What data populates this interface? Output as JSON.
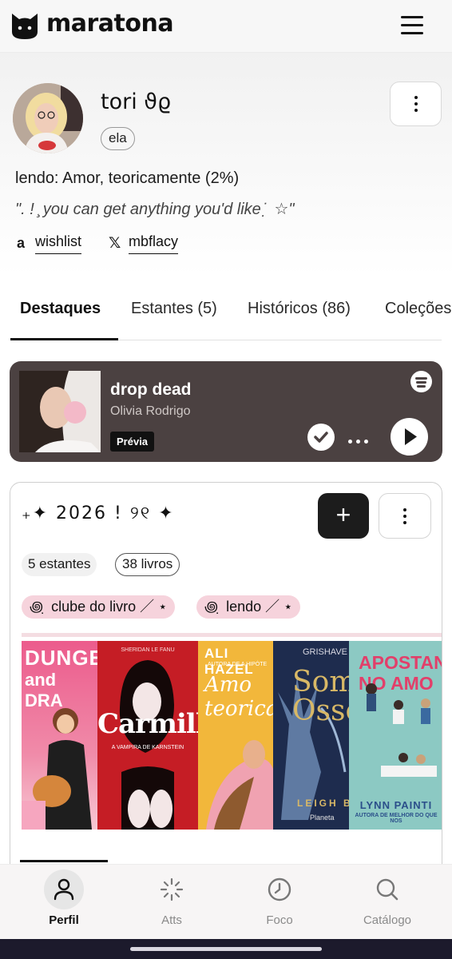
{
  "app": {
    "name": "maratona"
  },
  "profile": {
    "username": "tori ϑϱ",
    "pronoun": "ela",
    "reading": "lendo: Amor, teoricamente (2%)",
    "bio": "\". ! ̧ you can get anything you'd like ̇ ̣ ☆\"",
    "links": [
      {
        "label": "wishlist",
        "icon": "amazon-icon"
      },
      {
        "label": "mbflacy",
        "icon": "x-icon"
      }
    ]
  },
  "tabs": [
    {
      "label": "Destaques",
      "active": true
    },
    {
      "label": "Estantes (5)",
      "active": false
    },
    {
      "label": "Históricos (86)",
      "active": false
    },
    {
      "label": "Coleções",
      "active": false
    }
  ],
  "spotify": {
    "song": "drop dead",
    "artist": "Olivia Rodrigo",
    "badge": "Prévia"
  },
  "collection": {
    "title": "₊✦ 2026 ! ୨୧ ✦",
    "stats": [
      "5 estantes",
      "38 livros"
    ],
    "tags": [
      "꩜ ̣ clube do livro ／ ⋆",
      "꩜ ̣ lendo ／ ⋆"
    ],
    "books": [
      {
        "title_top": "DUNGE",
        "title_bottom": "and DRA"
      },
      {
        "author": "SHERIDAN LE FANU",
        "title": "Carmilla",
        "subtitle": "A VAMPIRA DE KARNSTEIN"
      },
      {
        "author": "ALI HAZEL",
        "tagline": "AUTORA DE A HIPÓTE",
        "title": "Amo teoricam"
      },
      {
        "author": "GRISHAVE",
        "title": "Some Osso",
        "byline": "LEIGH BAR",
        "publisher": "Planeta"
      },
      {
        "title": "APOSTANI NO AMO",
        "author": "LYNN PAINTI",
        "tagline": "AUTORA DE MELHOR DO QUE NOS"
      }
    ]
  },
  "nav": [
    {
      "label": "Perfil",
      "icon": "person-icon",
      "active": true
    },
    {
      "label": "Atts",
      "icon": "loading-spark-icon",
      "active": false
    },
    {
      "label": "Foco",
      "icon": "clock-icon",
      "active": false
    },
    {
      "label": "Catálogo",
      "icon": "search-icon",
      "active": false
    }
  ]
}
